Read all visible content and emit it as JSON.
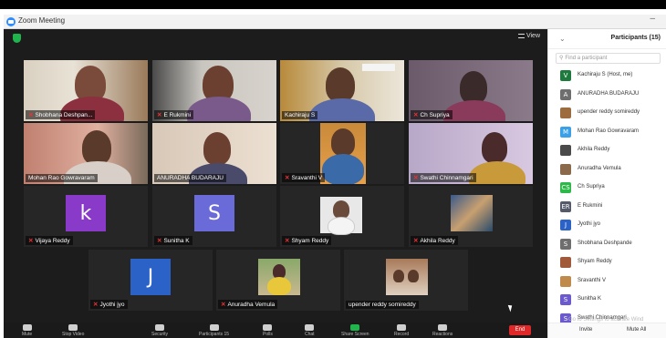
{
  "window": {
    "title": "Zoom Meeting"
  },
  "meeting": {
    "view_label": "View",
    "tiles": [
      {
        "name": "Shobhana Deshpan...",
        "mic_muted": true,
        "active": false
      },
      {
        "name": "E Rukmini",
        "mic_muted": true,
        "active": false
      },
      {
        "name": "Kachiraju S",
        "mic_muted": false,
        "active": true
      },
      {
        "name": "Ch Supriya",
        "mic_muted": true,
        "active": false
      },
      {
        "name": "Mohan Rao Gowravaram",
        "mic_muted": false,
        "active": false
      },
      {
        "name": "ANURADHA BUDARAJU",
        "mic_muted": false,
        "active": false
      },
      {
        "name": "Sravanthi V",
        "mic_muted": true,
        "active": false
      },
      {
        "name": "Swathi Chinnamgari",
        "mic_muted": true,
        "active": false
      },
      {
        "name": "Vijaya Reddy",
        "mic_muted": true,
        "active": false,
        "avatar_letter": "k"
      },
      {
        "name": "Sunitha K",
        "mic_muted": true,
        "active": false,
        "avatar_letter": "S"
      },
      {
        "name": "Shyam Reddy",
        "mic_muted": true,
        "active": false
      },
      {
        "name": "Akhila Reddy",
        "mic_muted": true,
        "active": false
      },
      {
        "name": "Jyothi jyo",
        "mic_muted": true,
        "active": false,
        "avatar_letter": "J"
      },
      {
        "name": "Anuradha Vemula",
        "mic_muted": true,
        "active": false
      },
      {
        "name": "upender reddy somireddy",
        "mic_muted": false,
        "active": false
      }
    ]
  },
  "toolbar": {
    "mute": "Mute",
    "stop_video": "Stop Video",
    "security": "Security",
    "participants": "Participants",
    "participants_count": "15",
    "polls": "Polls",
    "chat": "Chat",
    "share_screen": "Share Screen",
    "record": "Record",
    "reactions": "Reactions",
    "end": "End"
  },
  "panel": {
    "title": "Participants (15)",
    "search_placeholder": "Find a participant",
    "participants": [
      {
        "name": "Kachiraju S (Host, me)",
        "initial": "V",
        "color": "#1e7a3c"
      },
      {
        "name": "ANURADHA BUDARAJU",
        "initial": "A",
        "color": "#6e6e6e"
      },
      {
        "name": "upender reddy somireddy",
        "initial": "",
        "color": "#9c6b3e"
      },
      {
        "name": "Mohan Rao Gowravaram",
        "initial": "M",
        "color": "#3aa0e8"
      },
      {
        "name": "Akhila Reddy",
        "initial": "",
        "color": "#4a4a4a"
      },
      {
        "name": "Anuradha Vemula",
        "initial": "",
        "color": "#8a6a4a"
      },
      {
        "name": "Ch Supriya",
        "initial": "CS",
        "color": "#2eb84a"
      },
      {
        "name": "E Rukmini",
        "initial": "ER",
        "color": "#555a6a"
      },
      {
        "name": "Jyothi jyo",
        "initial": "J",
        "color": "#2a62c8"
      },
      {
        "name": "Shobhana Deshpande",
        "initial": "S",
        "color": "#6e6e6e"
      },
      {
        "name": "Shyam Reddy",
        "initial": "",
        "color": "#a05a3a"
      },
      {
        "name": "Sravanthi V",
        "initial": "",
        "color": "#c08a4a"
      },
      {
        "name": "Sunitha K",
        "initial": "S",
        "color": "#6a5acd"
      },
      {
        "name": "Swathi Chinnamgari",
        "initial": "S",
        "color": "#6a5acd"
      }
    ],
    "hint": "Go to Settings to activate Wind",
    "invite": "Invite",
    "mute_all": "Mute All"
  }
}
